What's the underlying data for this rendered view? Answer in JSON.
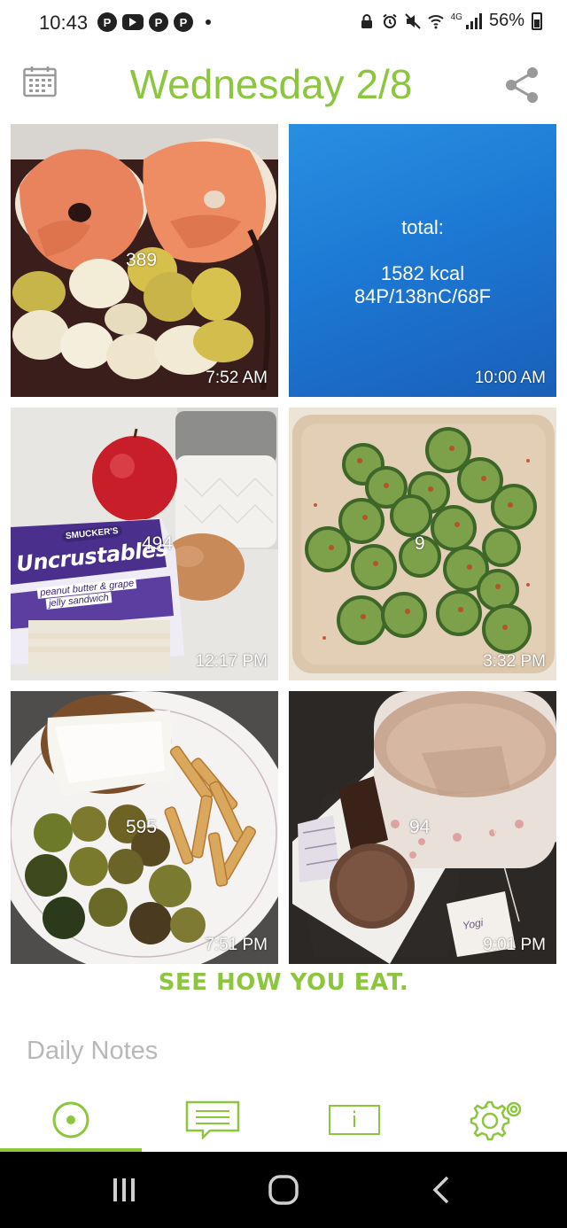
{
  "status_bar": {
    "time": "10:43",
    "network": "4G",
    "battery": "56%"
  },
  "header": {
    "title": "Wednesday 2/8"
  },
  "entries": [
    {
      "kcal": "389",
      "time": "7:52 AM"
    },
    {
      "summary_label": "total:",
      "summary_kcal": "1582 kcal",
      "summary_macros": "84P/138nC/68F",
      "time": "10:00 AM"
    },
    {
      "kcal": "494",
      "time": "12:17 PM",
      "package_brand": "SMUCKER'S",
      "package_name": "Uncrustables",
      "package_desc_1": "peanut butter & grape",
      "package_desc_2": "jelly sandwich"
    },
    {
      "kcal": "9",
      "time": "3:32 PM"
    },
    {
      "kcal": "595",
      "time": "7:51 PM"
    },
    {
      "kcal": "94",
      "time": "9:01 PM",
      "tea_tag": "Yogi"
    }
  ],
  "slogan": "SEE HOW YOU EAT.",
  "daily_notes": {
    "placeholder": "Daily Notes"
  },
  "toolbar": {
    "items": [
      "home-icon",
      "messages-icon",
      "info-icon",
      "settings-icon"
    ],
    "info_glyph": "i"
  },
  "colors": {
    "accent": "#8cc63f"
  }
}
